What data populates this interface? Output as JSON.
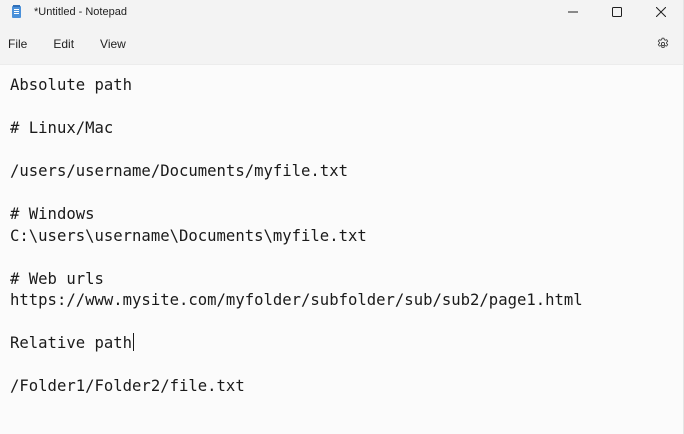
{
  "window": {
    "title": "*Untitled - Notepad"
  },
  "menu": {
    "items": [
      "File",
      "Edit",
      "View"
    ]
  },
  "editor": {
    "lines": [
      "Absolute path",
      "",
      "# Linux/Mac",
      "",
      "/users/username/Documents/myfile.txt",
      "",
      "# Windows",
      "C:\\users\\username\\Documents\\myfile.txt",
      "",
      "# Web urls",
      "https://www.mysite.com/myfolder/subfolder/sub/sub2/page1.html",
      "",
      "Relative path",
      "",
      "/Folder1/Folder2/file.txt"
    ]
  },
  "icons": {
    "app": "notepad-icon",
    "minimize": "minimize-icon",
    "maximize": "maximize-icon",
    "close": "close-icon",
    "settings": "gear-icon"
  }
}
